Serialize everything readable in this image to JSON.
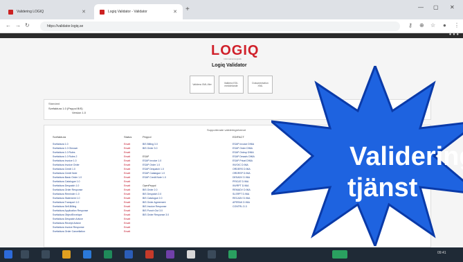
{
  "browser": {
    "tabs": [
      {
        "label": "Validering LOGIQ"
      },
      {
        "label": "Logiq Validator - Validator"
      }
    ],
    "url": "https://validator.logiq.se"
  },
  "app": {
    "logo": "LOGIQ",
    "tagline": "Informationslogistik",
    "subtitle": "Logiq Validator",
    "nav_buttons": [
      "Validera XML-filer",
      "Validera EDI-meddelande",
      "Dokumentation XML"
    ]
  },
  "selector": {
    "caption": "Standard",
    "value": "Svefaktura 1.0 (Peppol BIS)",
    "subvalue": "Version 1.0"
  },
  "list_panel": {
    "title": "Supporterade valideringsformat",
    "columns": [
      {
        "header": "Svefaktura",
        "items": [
          "Svefaktura 1.0",
          "Svefaktura 1.0 Oknown",
          "Svefaktura 1.0 Rules",
          "Svefaktura 1.0 Rules 2",
          "Svefaktura Invoice 1.0",
          "Svefaktura Invoice Order",
          "Svefaktura Credit 1.0",
          "Svefaktura Credit Note",
          "Svefaktura Basic Order 1.0",
          "Svefaktura Catalogue 1.0",
          "Svefaktura Despatch 1.0",
          "Svefaktura Order Response",
          "Svefaktura Reminder 1.0",
          "Svefaktura Statement 1.0",
          "Svefaktura Transport 1.0",
          "Svefaktura Self-Billing",
          "Svefaktura Application Response",
          "Svefaktura ObjectEnvelope",
          "Svefaktura Despatch Advice",
          "Svefaktura Receipt Advice",
          "Svefaktura Invoice Response",
          "Svefaktura Order Cancellation"
        ]
      },
      {
        "header": "Status",
        "items": [
          "Ersatt",
          "Ersatt",
          "Ersatt",
          "Ersatt",
          "Ersatt",
          "Ersatt",
          "Ersatt",
          "Ersatt",
          "Ersatt",
          "Ersatt",
          "Ersatt",
          "Ersatt",
          "Ersatt",
          "Ersatt",
          "Ersatt",
          "Ersatt",
          "Ersatt",
          "Ersatt",
          "Ersatt",
          "Ersatt",
          "Ersatt",
          "Ersatt"
        ]
      },
      {
        "header": "Peppol",
        "groups": [
          {
            "items": [
              "BIS Billing 3.0",
              "BIS Order 3.0"
            ]
          },
          {
            "header": "ESAP",
            "items": [
              "ESAP Invoice 1.0",
              "ESAP Order 1.0",
              "ESAP Despatch 1.0",
              "ESAP Catalogue 1.0",
              "ESAP Credit Note 1.0"
            ]
          },
          {
            "header": "OpenPeppol",
            "items": [
              "BIS Order 2.0",
              "BIS Despatch 2.0",
              "BIS Catalogue 2.0",
              "BIS Order Agreement",
              "BIS Invoice Response",
              "BIS Punch Out 3.0",
              "BIS Order Response 3.0"
            ]
          }
        ]
      },
      {
        "header": "EDIFACT",
        "items": [
          "ESAP Invoice D96A",
          "ESAP Order D96A",
          "ESAP Ordrsp D96A",
          "ESAP Desadv D96A",
          "ESAP Pricat D96A",
          "INVOIC D.96A",
          "ORDERS D.96A",
          "ORDRSP D.96A",
          "DESADV D.96A",
          "PRICAT D.96A",
          "INVRPT D.96A",
          "REMADV D.96A",
          "SLSRPT D.96A",
          "RECADV D.96A",
          "APERAK D.96A",
          "CONTRL D.3"
        ]
      }
    ]
  },
  "overlay": {
    "line1": "Validering",
    "line2": "tjänst",
    "fill": "#1e63e0",
    "stroke": "#0a3aa8",
    "text_color": "#ffffff"
  },
  "taskbar": {
    "clock": "09:41"
  },
  "colors": {
    "brand_red": "#d0202a",
    "link_blue": "#1a3f8a"
  }
}
